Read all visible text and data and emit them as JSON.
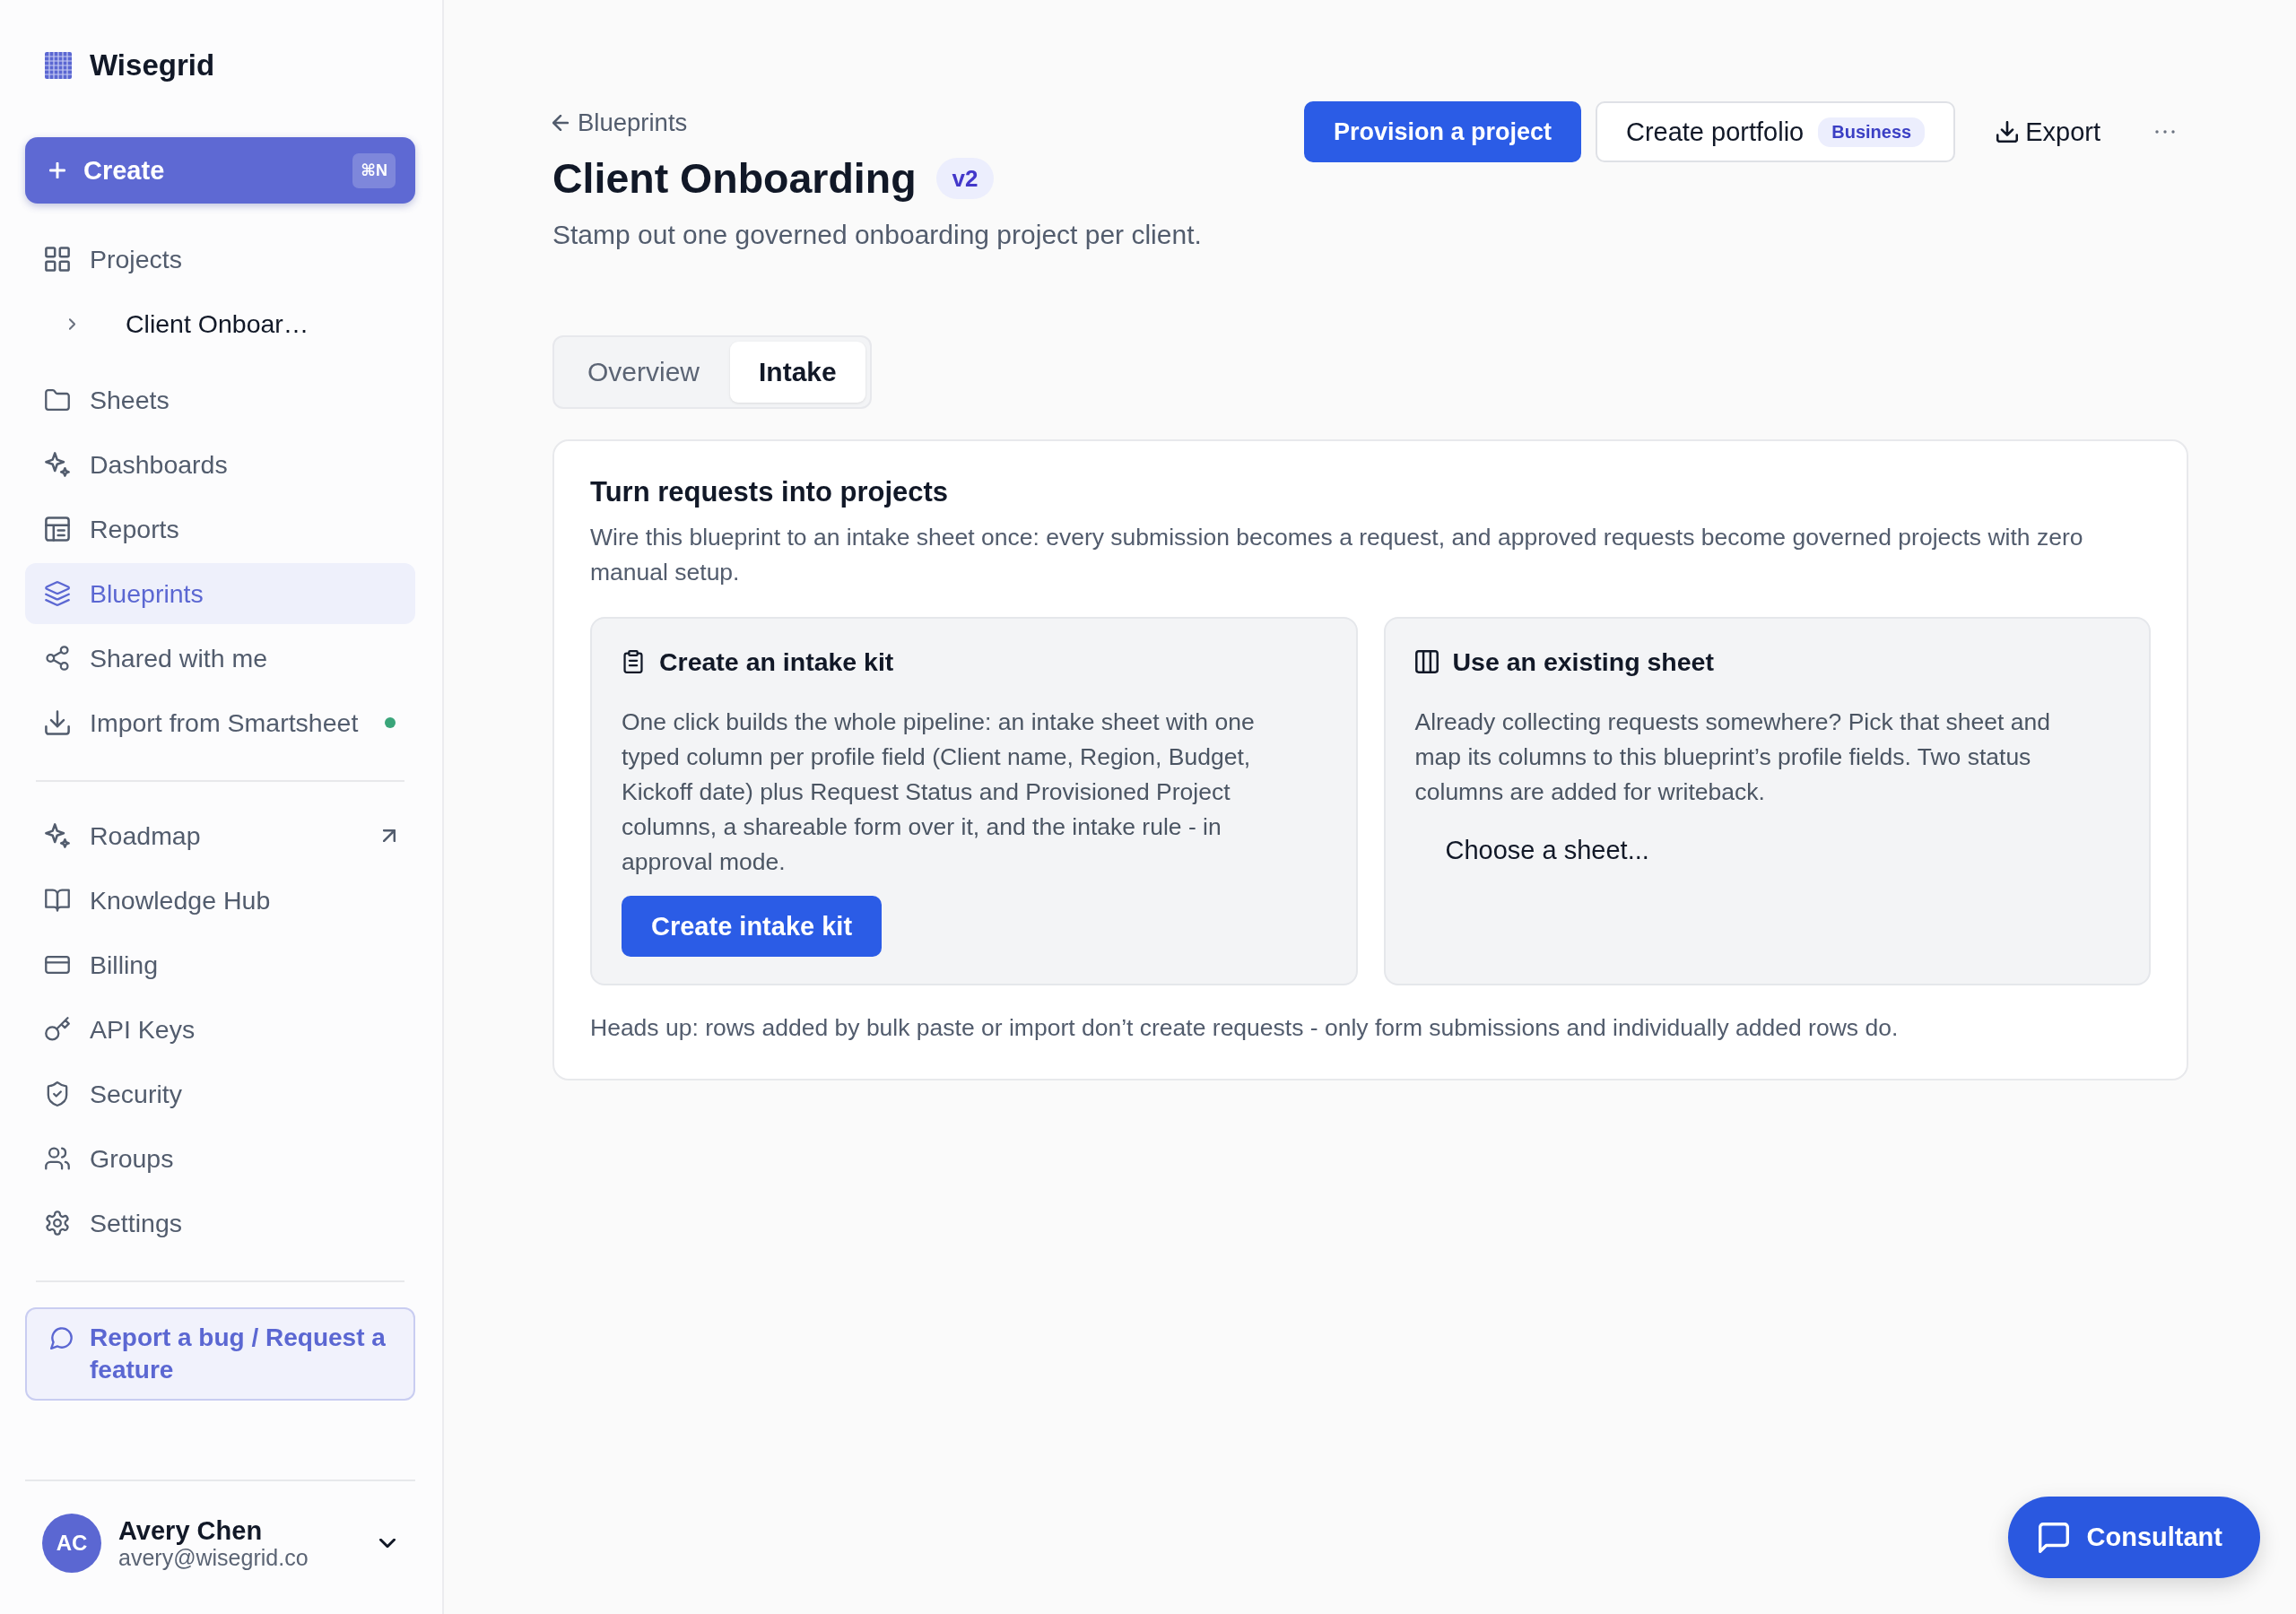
{
  "sidebar": {
    "brand": "Wisegrid",
    "create_button": {
      "label": "Create",
      "shortcut": "⌘N"
    },
    "nav_groups": [
      {
        "items": [
          {
            "label": "Projects",
            "selected": false,
            "notify": false,
            "external": false,
            "children": [
              {
                "label": "Client Onboar…",
                "expanded": false
              }
            ]
          },
          {
            "label": "Sheets",
            "selected": false,
            "notify": false,
            "external": false
          },
          {
            "label": "Dashboards",
            "selected": false,
            "notify": false,
            "external": false
          },
          {
            "label": "Reports",
            "selected": false,
            "notify": false,
            "external": false
          },
          {
            "label": "Blueprints",
            "selected": true,
            "notify": false,
            "external": false
          },
          {
            "label": "Shared with me",
            "selected": false,
            "notify": false,
            "external": false
          },
          {
            "label": "Import from Smartsheet",
            "selected": false,
            "notify": true,
            "external": false
          }
        ]
      },
      {
        "items": [
          {
            "label": "Roadmap",
            "selected": false,
            "notify": false,
            "external": true
          },
          {
            "label": "Knowledge Hub",
            "selected": false,
            "notify": false,
            "external": false
          },
          {
            "label": "Billing",
            "selected": false,
            "notify": false,
            "external": false
          },
          {
            "label": "API Keys",
            "selected": false,
            "notify": false,
            "external": false
          },
          {
            "label": "Security",
            "selected": false,
            "notify": false,
            "external": false
          },
          {
            "label": "Groups",
            "selected": false,
            "notify": false,
            "external": false
          },
          {
            "label": "Settings",
            "selected": false,
            "notify": false,
            "external": false
          }
        ]
      }
    ],
    "feedback_button": {
      "label": "Report a bug / Request a feature"
    },
    "user": {
      "initials": "AC",
      "name": "Avery Chen",
      "email": "avery@wisegrid.co"
    }
  },
  "main": {
    "back_link": {
      "label": "Blueprints"
    },
    "title": "Client Onboarding",
    "version": "v2",
    "subtitle": "Stamp out one governed onboarding project per client.",
    "actions": [
      {
        "kind": "primary",
        "label": "Provision a project"
      },
      {
        "kind": "outline",
        "label": "Create portfolio",
        "badge": "Business"
      },
      {
        "kind": "download",
        "label": "Export"
      },
      {
        "kind": "more"
      }
    ],
    "tabs": [
      {
        "label": "Overview",
        "selected": false
      },
      {
        "label": "Intake",
        "selected": true
      }
    ],
    "intake_card": {
      "title": "Turn requests into projects",
      "description": "Wire this blueprint to an intake sheet once: every submission becomes a request, and approved requests become governed projects with zero manual setup.",
      "options": [
        {
          "kind": "kit",
          "title": "Create an intake kit",
          "body": "One click builds the whole pipeline: an intake sheet with one typed column per profile field (Client name, Region, Budget, Kickoff date) plus Request Status and Provisioned Project columns, a shareable form over it, and the intake rule - in approval mode.",
          "button": "Create intake kit"
        },
        {
          "kind": "sheet",
          "title": "Use an existing sheet",
          "body": "Already collecting requests somewhere? Pick that sheet and map its columns to this blueprint’s profile fields. Two status columns are added for writeback.",
          "picker": "Choose a sheet..."
        }
      ],
      "note": "Heads up: rows added by bulk paste or import don’t create requests - only form submissions and individually added rows do."
    },
    "consultant_button": {
      "label": "Consultant"
    }
  }
}
